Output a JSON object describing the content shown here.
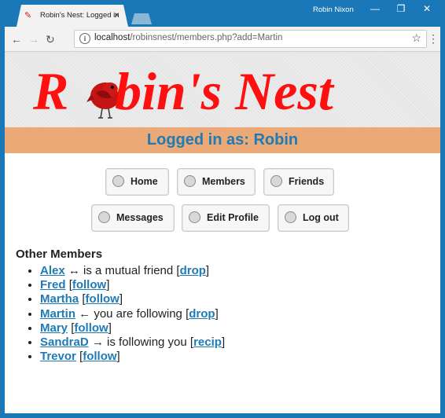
{
  "window": {
    "tab_title": "Robin's Nest: Logged in",
    "user": "Robin Nixon",
    "url_host": "localhost",
    "url_path": "/robinsnest/members.php?add=Martin"
  },
  "site": {
    "title_part1": "R",
    "title_part2": "bin's Nest",
    "logged_in": "Logged in as: Robin"
  },
  "nav": {
    "home": "Home",
    "members": "Members",
    "friends": "Friends",
    "messages": "Messages",
    "edit_profile": "Edit Profile",
    "log_out": "Log out"
  },
  "members_heading": "Other Members",
  "members": [
    {
      "name": "Alex",
      "status": " ↔ is a mutual friend ",
      "action": "drop"
    },
    {
      "name": "Fred",
      "status": " ",
      "action": "follow"
    },
    {
      "name": "Martha",
      "status": " ",
      "action": "follow"
    },
    {
      "name": "Martin",
      "status": " ← you are following ",
      "action": "drop"
    },
    {
      "name": "Mary",
      "status": " ",
      "action": "follow"
    },
    {
      "name": "SandraD",
      "status": " → is following you ",
      "action": "recip"
    },
    {
      "name": "Trevor",
      "status": " ",
      "action": "follow"
    }
  ],
  "colors": {
    "accent": "#1f7ab6",
    "logo_red": "#ff1010",
    "banner": "#eba977",
    "chrome_frame": "#1a78b8"
  }
}
